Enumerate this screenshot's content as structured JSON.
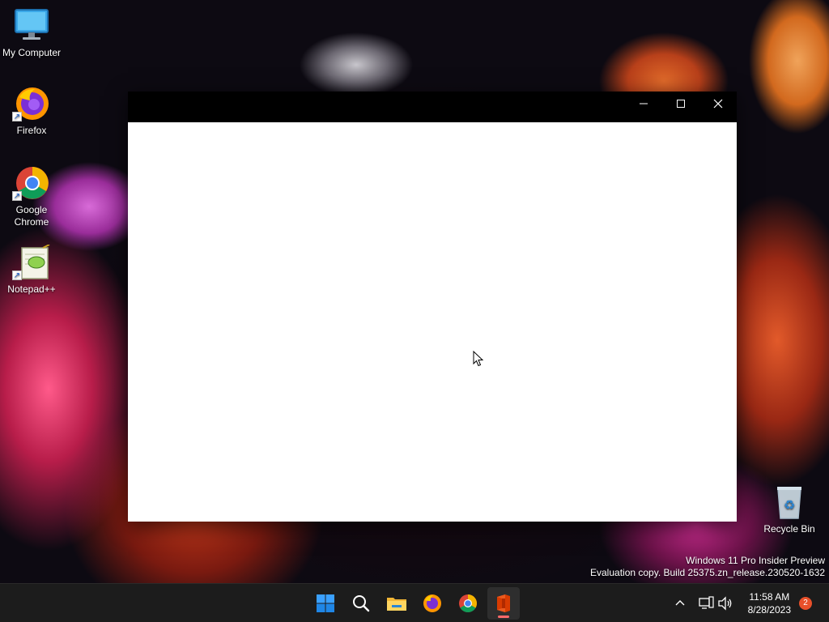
{
  "desktop": {
    "icons": [
      {
        "label": "My Computer",
        "icon": "monitor-icon"
      },
      {
        "label": "Firefox",
        "icon": "firefox-icon"
      },
      {
        "label": "Google\nChrome",
        "icon": "chrome-icon"
      },
      {
        "label": "Notepad++",
        "icon": "notepad-plus-plus-icon"
      }
    ],
    "recycle_bin": {
      "label": "Recycle Bin",
      "icon": "recycle-bin-icon"
    }
  },
  "window": {
    "controls": {
      "minimize": "minimize-icon",
      "maximize": "maximize-icon",
      "close": "close-icon"
    }
  },
  "watermark": {
    "line1": "Windows 11 Pro Insider Preview",
    "line2": "Evaluation copy. Build 25375.zn_release.230520-1632"
  },
  "taskbar": {
    "apps": [
      "start-icon",
      "search-icon",
      "file-explorer-icon",
      "firefox-icon",
      "chrome-icon",
      "office-icon"
    ],
    "tray": {
      "chevron": "chevron-up-icon",
      "network": "network-icon",
      "volume": "volume-icon",
      "time": "11:58 AM",
      "date": "8/28/2023",
      "notifications": "2"
    }
  },
  "colors": {
    "taskbar": "#1c1c1c",
    "titlebar": "#000000",
    "accent": "#0078d4",
    "badge": "#e8502a"
  }
}
